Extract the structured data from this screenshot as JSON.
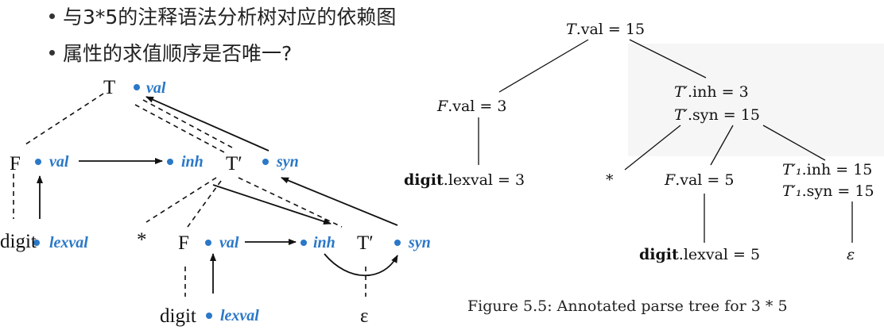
{
  "bullets": [
    "与3*5的注释语法分析树对应的依赖图",
    "属性的求值顺序是否唯一?"
  ],
  "dep_graph": {
    "nodes": {
      "T": "T",
      "F1": "F",
      "Tp1": "T′",
      "digit1": "digit",
      "star": "*",
      "F2": "F",
      "Tp2": "T′",
      "digit2": "digit",
      "eps": "ε"
    },
    "attrs": {
      "val": "val",
      "inh": "inh",
      "syn": "syn",
      "lexval": "lexval"
    },
    "attr_color": "#2a78c8"
  },
  "parse_tree": {
    "root_T": "T",
    "root_val": ".val = 15",
    "F1": "F",
    "F1_val": ".val = 3",
    "Tp_inh_label": "T′",
    "Tp_inh": ".inh = 3",
    "Tp_syn_label": "T′",
    "Tp_syn": ".syn = 15",
    "digit": "digit",
    "lexval3": ".lexval = 3",
    "star": "*",
    "F2": "F",
    "F2_val": ".val = 5",
    "Tp1_inh_label": "T′₁",
    "Tp1_inh": ".inh = 15",
    "Tp1_syn_label": "T′₁",
    "Tp1_syn": ".syn = 15",
    "lexval5": ".lexval = 5",
    "eps": "ε",
    "caption": "Figure 5.5: Annotated parse tree for 3 * 5"
  }
}
